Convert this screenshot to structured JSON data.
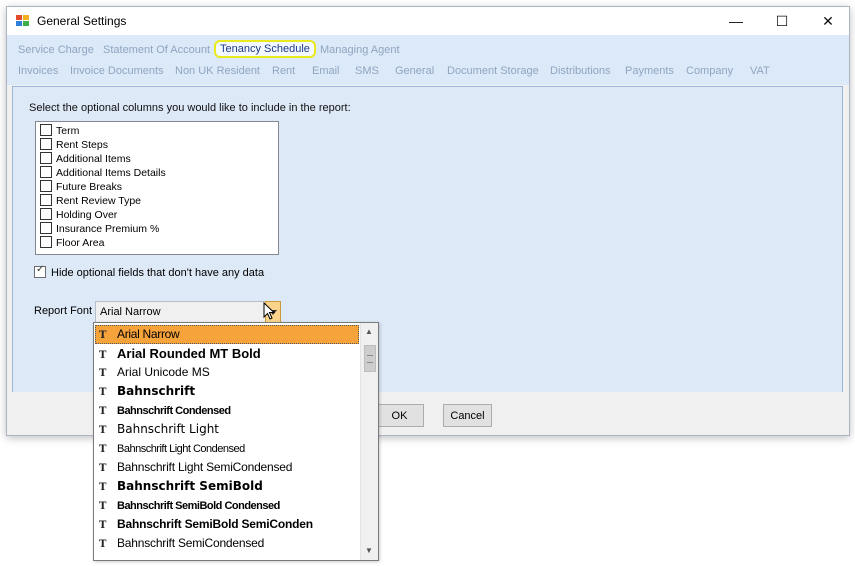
{
  "window": {
    "title": "General Settings"
  },
  "tabs": {
    "row1": [
      "Service Charge",
      "Statement Of Account",
      "Tenancy Schedule",
      "Managing Agent"
    ],
    "row2": [
      "Invoices",
      "Invoice Documents",
      "Non UK Resident",
      "Rent",
      "Email",
      "SMS",
      "General",
      "Document Storage",
      "Distributions",
      "Payments",
      "Company",
      "VAT"
    ],
    "active": "Tenancy Schedule"
  },
  "content": {
    "intro": "Select the optional columns you would like to include in the report:",
    "columns": [
      "Term",
      "Rent Steps",
      "Additional Items",
      "Additional Items Details",
      "Future Breaks",
      "Rent Review Type",
      "Holding Over",
      "Insurance Premium %",
      "Floor Area"
    ],
    "hide_optional_label": "Hide optional fields that don't have any data",
    "hide_optional_checked": true,
    "report_font_label": "Report Font",
    "report_font_value": "Arial Narrow"
  },
  "font_dropdown": {
    "items": [
      "Arial Narrow",
      "Arial Rounded MT Bold",
      "Arial Unicode MS",
      "Bahnschrift",
      "Bahnschrift Condensed",
      "Bahnschrift Light",
      "Bahnschrift Light Condensed",
      "Bahnschrift Light SemiCondensed",
      "Bahnschrift SemiBold",
      "Bahnschrift SemiBold Condensed",
      "Bahnschrift SemiBold SemiConden",
      "Bahnschrift SemiCondensed"
    ],
    "selected": "Arial Narrow",
    "truetype_icon": "truetype-font-icon"
  },
  "buttons": {
    "ok": "OK",
    "cancel": "Cancel"
  },
  "titlebar_controls": {
    "minimize": "—",
    "maximize": "☐",
    "close": "✕"
  },
  "colors": {
    "selected_item": "#f7a33c",
    "tab_highlight": "#e8ea1c",
    "panel_bg": "#dde9f7",
    "tab_strip_bg": "#dce9f8"
  }
}
